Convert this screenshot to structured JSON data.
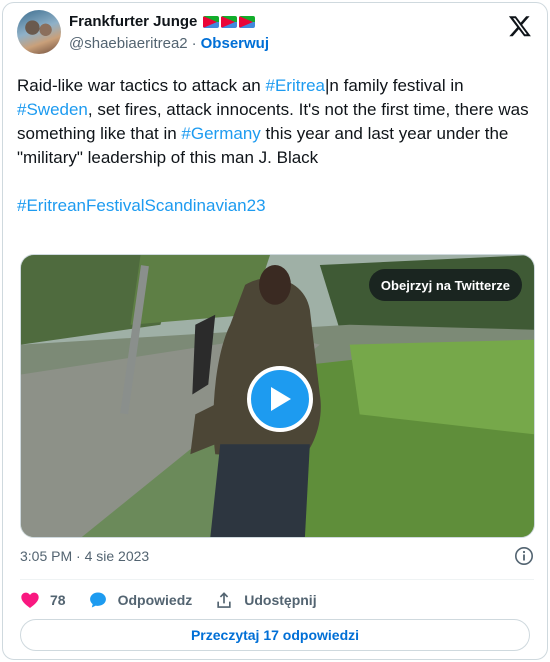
{
  "author": {
    "name": "Frankfurter Junge",
    "handle": "@shaebiaeritrea2",
    "separator": "·",
    "follow_label": "Obserwuj"
  },
  "tweet": {
    "line_parts": [
      {
        "text": "Raid-like war tactics to attack an ",
        "hashtag": false
      },
      {
        "text": "#Eritrea",
        "hashtag": true
      },
      {
        "text": "|n family festival in ",
        "hashtag": false
      },
      {
        "text": "#Sweden",
        "hashtag": true
      },
      {
        "text": ", set fires, attack innocents. It's not the first time, there was something like that in ",
        "hashtag": false
      },
      {
        "text": "#Germany",
        "hashtag": true
      },
      {
        "text": " this year and last year under the \"military\" leadership of this man J. Black",
        "hashtag": false
      }
    ],
    "hashtag_line": "#EritreanFestivalScandinavian23"
  },
  "media": {
    "watch_label": "Obejrzyj na Twitterze"
  },
  "meta": {
    "timestamp": "3:05 PM · 4 sie 2023"
  },
  "actions": {
    "likes": "78",
    "reply_label": "Odpowiedz",
    "share_label": "Udostępnij"
  },
  "read_replies_label": "Przeczytaj 17 odpowiedzi",
  "colors": {
    "accent": "#1d9bf0",
    "link": "#006fd6",
    "like": "#f91880",
    "muted": "#536471"
  },
  "icons": [
    "x-logo-icon",
    "play-icon",
    "info-icon",
    "heart-icon",
    "reply-bubble-icon",
    "share-icon",
    "eritrea-flag-icon"
  ]
}
